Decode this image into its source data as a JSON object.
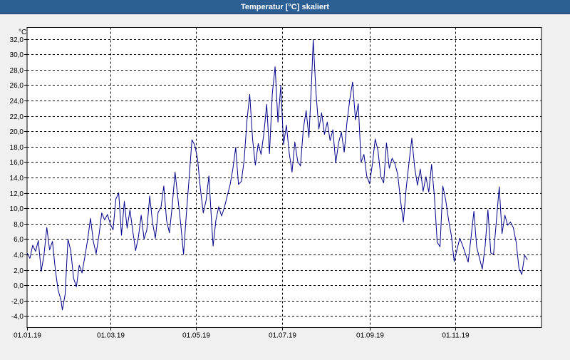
{
  "window": {
    "title": "Temperatur [°C] skaliert"
  },
  "chart_data": {
    "type": "line",
    "title": "Temperatur [°C] skaliert",
    "ylabel": "°C",
    "xlabel": "",
    "ylim": [
      -5.5,
      33.5
    ],
    "xlim": [
      "2019-01-01",
      "2019-12-31"
    ],
    "y_ticks": [
      "32,0",
      "30,0",
      "28,0",
      "26,0",
      "24,0",
      "22,0",
      "20,0",
      "18,0",
      "16,0",
      "14,0",
      "12,0",
      "10,0",
      "8,0",
      "6,0",
      "4,0",
      "2,0",
      "0,0",
      "-2,0",
      "-4,0"
    ],
    "y_tick_values": [
      32,
      30,
      28,
      26,
      24,
      22,
      20,
      18,
      16,
      14,
      12,
      10,
      8,
      6,
      4,
      2,
      0,
      -2,
      -4
    ],
    "x_ticks": [
      "01.01.19",
      "01.03.19",
      "01.05.19",
      "01.07.19",
      "01.09.19",
      "01.11.19"
    ],
    "x_tick_dates": [
      "2019-01-01",
      "2019-03-01",
      "2019-05-01",
      "2019-07-01",
      "2019-09-01",
      "2019-11-01"
    ],
    "grid": true,
    "legend": "none",
    "series": [
      {
        "color": "#00008b",
        "points": [
          [
            "2019-01-01",
            4.2
          ],
          [
            "2019-01-03",
            3.5
          ],
          [
            "2019-01-05",
            5.2
          ],
          [
            "2019-01-07",
            4.4
          ],
          [
            "2019-01-09",
            5.8
          ],
          [
            "2019-01-11",
            1.8
          ],
          [
            "2019-01-13",
            3.9
          ],
          [
            "2019-01-15",
            7.5
          ],
          [
            "2019-01-17",
            4.6
          ],
          [
            "2019-01-19",
            5.7
          ],
          [
            "2019-01-21",
            2.1
          ],
          [
            "2019-01-23",
            -0.6
          ],
          [
            "2019-01-25",
            -1.9
          ],
          [
            "2019-01-26",
            -3.2
          ],
          [
            "2019-01-28",
            -1.2
          ],
          [
            "2019-01-30",
            6.0
          ],
          [
            "2019-02-01",
            4.5
          ],
          [
            "2019-02-03",
            0.9
          ],
          [
            "2019-02-05",
            -0.2
          ],
          [
            "2019-02-07",
            2.6
          ],
          [
            "2019-02-09",
            1.6
          ],
          [
            "2019-02-11",
            3.7
          ],
          [
            "2019-02-13",
            6.0
          ],
          [
            "2019-02-15",
            8.7
          ],
          [
            "2019-02-17",
            5.7
          ],
          [
            "2019-02-19",
            4.1
          ],
          [
            "2019-02-21",
            6.5
          ],
          [
            "2019-02-23",
            9.4
          ],
          [
            "2019-02-25",
            8.5
          ],
          [
            "2019-02-27",
            9.2
          ],
          [
            "2019-03-01",
            8.0
          ],
          [
            "2019-03-03",
            7.2
          ],
          [
            "2019-03-05",
            11.2
          ],
          [
            "2019-03-07",
            12.0
          ],
          [
            "2019-03-09",
            6.5
          ],
          [
            "2019-03-11",
            10.9
          ],
          [
            "2019-03-13",
            7.4
          ],
          [
            "2019-03-15",
            9.8
          ],
          [
            "2019-03-17",
            7.0
          ],
          [
            "2019-03-19",
            4.5
          ],
          [
            "2019-03-21",
            6.3
          ],
          [
            "2019-03-23",
            9.1
          ],
          [
            "2019-03-25",
            6.0
          ],
          [
            "2019-03-27",
            7.2
          ],
          [
            "2019-03-29",
            11.6
          ],
          [
            "2019-03-31",
            8.2
          ],
          [
            "2019-04-02",
            6.1
          ],
          [
            "2019-04-04",
            9.5
          ],
          [
            "2019-04-06",
            10.1
          ],
          [
            "2019-04-08",
            12.9
          ],
          [
            "2019-04-10",
            8.4
          ],
          [
            "2019-04-12",
            6.8
          ],
          [
            "2019-04-14",
            10.3
          ],
          [
            "2019-04-16",
            14.7
          ],
          [
            "2019-04-18",
            11.3
          ],
          [
            "2019-04-20",
            8.0
          ],
          [
            "2019-04-22",
            4.0
          ],
          [
            "2019-04-24",
            9.2
          ],
          [
            "2019-04-26",
            14.0
          ],
          [
            "2019-04-28",
            18.9
          ],
          [
            "2019-04-30",
            18.2
          ],
          [
            "2019-05-02",
            16.4
          ],
          [
            "2019-05-04",
            12.5
          ],
          [
            "2019-05-06",
            9.4
          ],
          [
            "2019-05-08",
            11.0
          ],
          [
            "2019-05-10",
            14.2
          ],
          [
            "2019-05-12",
            8.0
          ],
          [
            "2019-05-13",
            5.1
          ],
          [
            "2019-05-15",
            8.5
          ],
          [
            "2019-05-17",
            10.2
          ],
          [
            "2019-05-19",
            9.0
          ],
          [
            "2019-05-21",
            10.1
          ],
          [
            "2019-05-23",
            11.6
          ],
          [
            "2019-05-25",
            13.0
          ],
          [
            "2019-05-27",
            15.1
          ],
          [
            "2019-05-29",
            17.9
          ],
          [
            "2019-05-31",
            13.1
          ],
          [
            "2019-06-02",
            13.5
          ],
          [
            "2019-06-04",
            16.2
          ],
          [
            "2019-06-06",
            21.4
          ],
          [
            "2019-06-08",
            24.8
          ],
          [
            "2019-06-10",
            19.0
          ],
          [
            "2019-06-12",
            15.6
          ],
          [
            "2019-06-14",
            18.4
          ],
          [
            "2019-06-16",
            17.0
          ],
          [
            "2019-06-18",
            19.7
          ],
          [
            "2019-06-20",
            23.5
          ],
          [
            "2019-06-22",
            17.1
          ],
          [
            "2019-06-24",
            24.9
          ],
          [
            "2019-06-26",
            28.4
          ],
          [
            "2019-06-28",
            21.2
          ],
          [
            "2019-06-30",
            25.9
          ],
          [
            "2019-07-02",
            18.3
          ],
          [
            "2019-07-04",
            20.8
          ],
          [
            "2019-07-06",
            17.2
          ],
          [
            "2019-07-08",
            14.7
          ],
          [
            "2019-07-10",
            18.6
          ],
          [
            "2019-07-12",
            16.1
          ],
          [
            "2019-07-14",
            15.5
          ],
          [
            "2019-07-16",
            20.3
          ],
          [
            "2019-07-18",
            22.7
          ],
          [
            "2019-07-20",
            19.2
          ],
          [
            "2019-07-22",
            27.1
          ],
          [
            "2019-07-23",
            31.9
          ],
          [
            "2019-07-25",
            25.0
          ],
          [
            "2019-07-27",
            20.3
          ],
          [
            "2019-07-29",
            22.4
          ],
          [
            "2019-07-31",
            19.6
          ],
          [
            "2019-08-02",
            21.2
          ],
          [
            "2019-08-04",
            18.8
          ],
          [
            "2019-08-06",
            20.2
          ],
          [
            "2019-08-08",
            15.9
          ],
          [
            "2019-08-10",
            18.5
          ],
          [
            "2019-08-12",
            19.9
          ],
          [
            "2019-08-14",
            17.3
          ],
          [
            "2019-08-16",
            21.2
          ],
          [
            "2019-08-18",
            24.2
          ],
          [
            "2019-08-20",
            26.4
          ],
          [
            "2019-08-22",
            21.5
          ],
          [
            "2019-08-24",
            23.6
          ],
          [
            "2019-08-26",
            16.0
          ],
          [
            "2019-08-28",
            17.0
          ],
          [
            "2019-08-30",
            14.2
          ],
          [
            "2019-09-01",
            13.2
          ],
          [
            "2019-09-03",
            15.7
          ],
          [
            "2019-09-05",
            19.0
          ],
          [
            "2019-09-07",
            17.5
          ],
          [
            "2019-09-09",
            14.1
          ],
          [
            "2019-09-11",
            13.3
          ],
          [
            "2019-09-13",
            18.5
          ],
          [
            "2019-09-15",
            15.2
          ],
          [
            "2019-09-17",
            16.5
          ],
          [
            "2019-09-19",
            15.8
          ],
          [
            "2019-09-21",
            14.4
          ],
          [
            "2019-09-23",
            11.0
          ],
          [
            "2019-09-25",
            8.2
          ],
          [
            "2019-09-27",
            12.6
          ],
          [
            "2019-09-29",
            16.0
          ],
          [
            "2019-10-01",
            19.1
          ],
          [
            "2019-10-03",
            15.3
          ],
          [
            "2019-10-05",
            13.0
          ],
          [
            "2019-10-07",
            15.1
          ],
          [
            "2019-10-09",
            12.2
          ],
          [
            "2019-10-11",
            14.1
          ],
          [
            "2019-10-13",
            12.1
          ],
          [
            "2019-10-15",
            15.7
          ],
          [
            "2019-10-17",
            11.5
          ],
          [
            "2019-10-19",
            5.6
          ],
          [
            "2019-10-21",
            5.0
          ],
          [
            "2019-10-23",
            12.9
          ],
          [
            "2019-10-25",
            11.1
          ],
          [
            "2019-10-27",
            8.6
          ],
          [
            "2019-10-29",
            6.5
          ],
          [
            "2019-10-31",
            3.1
          ],
          [
            "2019-11-02",
            4.6
          ],
          [
            "2019-11-04",
            6.1
          ],
          [
            "2019-11-06",
            5.2
          ],
          [
            "2019-11-08",
            4.1
          ],
          [
            "2019-11-10",
            3.0
          ],
          [
            "2019-11-12",
            6.2
          ],
          [
            "2019-11-14",
            9.6
          ],
          [
            "2019-11-16",
            5.0
          ],
          [
            "2019-11-18",
            3.5
          ],
          [
            "2019-11-20",
            2.1
          ],
          [
            "2019-11-22",
            5.1
          ],
          [
            "2019-11-24",
            9.8
          ],
          [
            "2019-11-26",
            4.2
          ],
          [
            "2019-11-28",
            4.0
          ],
          [
            "2019-11-30",
            8.4
          ],
          [
            "2019-12-02",
            12.8
          ],
          [
            "2019-12-04",
            6.7
          ],
          [
            "2019-12-06",
            9.1
          ],
          [
            "2019-12-08",
            7.8
          ],
          [
            "2019-12-10",
            8.2
          ],
          [
            "2019-12-12",
            7.5
          ],
          [
            "2019-12-14",
            5.6
          ],
          [
            "2019-12-16",
            2.2
          ],
          [
            "2019-12-18",
            1.4
          ],
          [
            "2019-12-20",
            3.9
          ],
          [
            "2019-12-22",
            3.3
          ]
        ]
      }
    ]
  }
}
